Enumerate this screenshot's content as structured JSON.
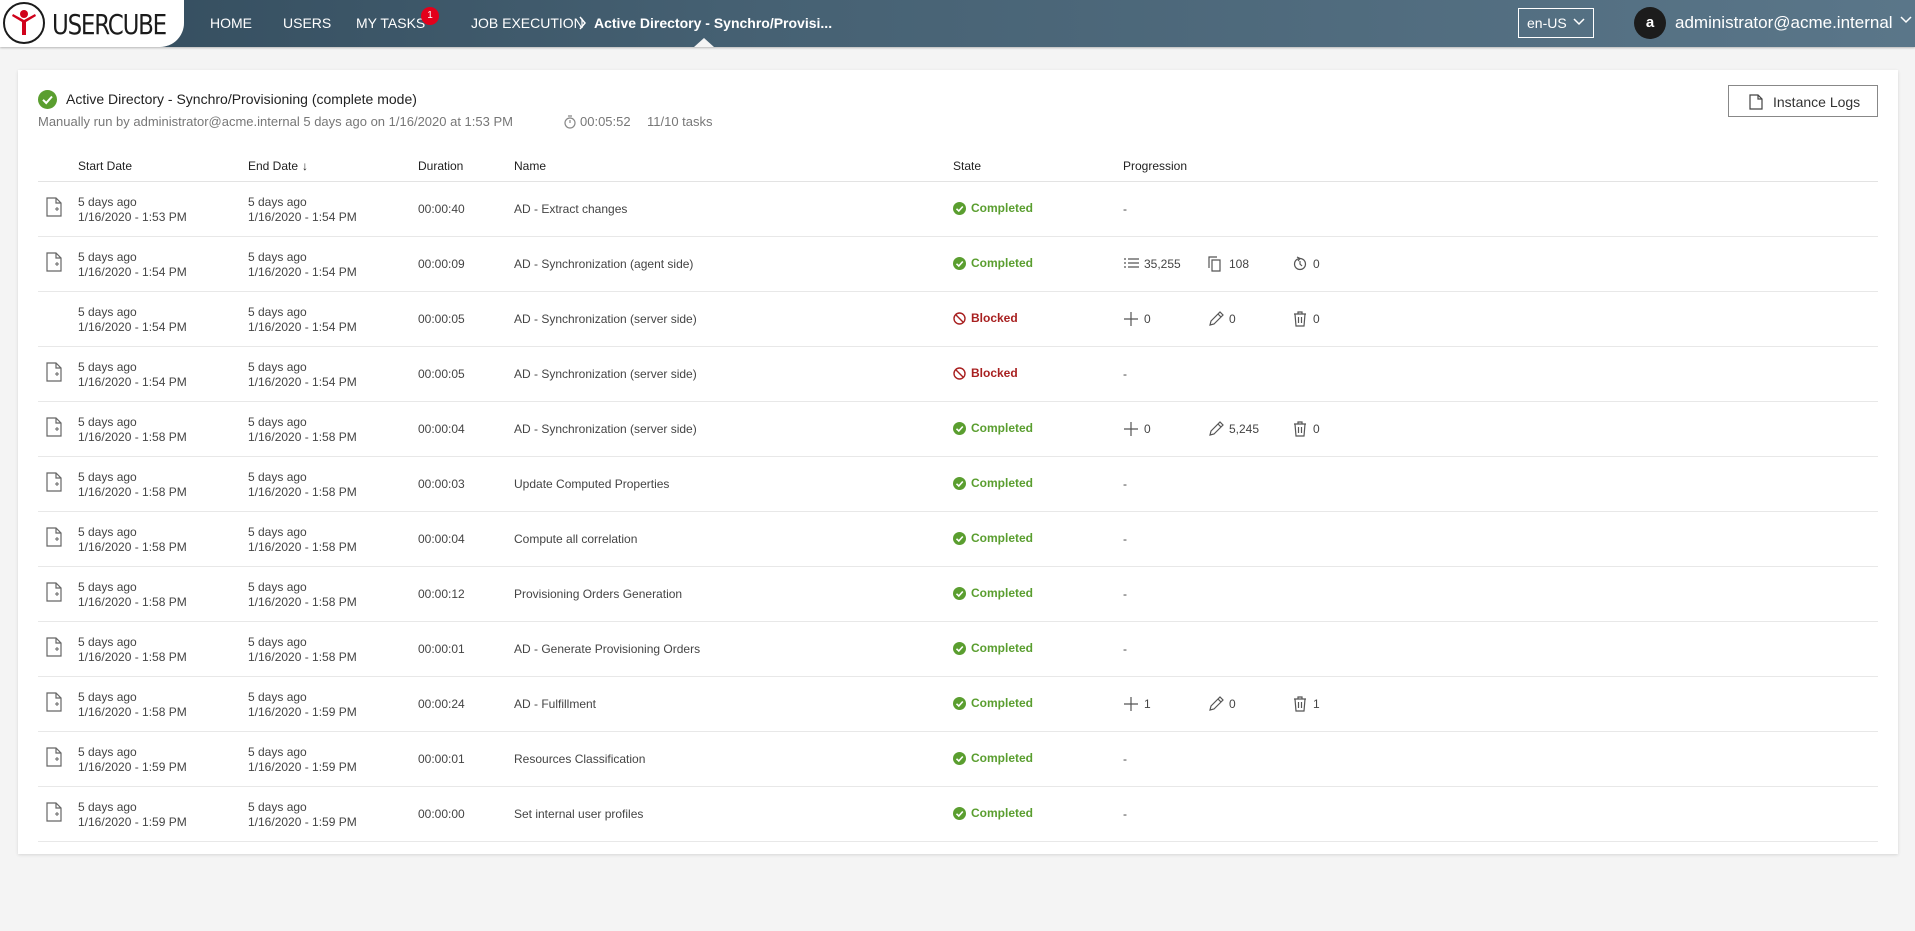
{
  "app": {
    "logo_text": "USERCUBE",
    "nav": {
      "home": "HOME",
      "users": "USERS",
      "my_tasks": "MY TASKS",
      "my_tasks_badge": "1",
      "job_execution": "JOB EXECUTION",
      "breadcrumb_current": "Active Directory - Synchro/Provisi..."
    },
    "language": "en-US",
    "user": {
      "avatar_letter": "a",
      "name": "administrator@acme.internal"
    }
  },
  "job": {
    "title": "Active Directory - Synchro/Provisioning (complete mode)",
    "subtitle": "Manually run by administrator@acme.internal 5 days ago on 1/16/2020 at 1:53 PM",
    "duration": "00:05:52",
    "tasks": "11/10 tasks",
    "instance_logs_label": "Instance Logs"
  },
  "table": {
    "headers": {
      "start": "Start Date",
      "end": "End Date",
      "duration": "Duration",
      "name": "Name",
      "state": "State",
      "progression": "Progression"
    },
    "rows": [
      {
        "icon": true,
        "start_rel": "5 days ago",
        "start": "1/16/2020 - 1:53 PM",
        "end_rel": "5 days ago",
        "end": "1/16/2020 - 1:54 PM",
        "duration": "00:00:40",
        "name": "AD - Extract changes",
        "state": "Completed",
        "progress": "-"
      },
      {
        "icon": true,
        "start_rel": "5 days ago",
        "start": "1/16/2020 - 1:54 PM",
        "end_rel": "5 days ago",
        "end": "1/16/2020 - 1:54 PM",
        "duration": "00:00:09",
        "name": "AD - Synchronization (agent side)",
        "state": "Completed",
        "progress_items": [
          {
            "icon": "list-icon",
            "value": "35,255"
          },
          {
            "icon": "copy-icon",
            "value": "108"
          },
          {
            "icon": "clock-refresh-icon",
            "value": "0"
          }
        ]
      },
      {
        "icon": false,
        "start_rel": "5 days ago",
        "start": "1/16/2020 - 1:54 PM",
        "end_rel": "5 days ago",
        "end": "1/16/2020 - 1:54 PM",
        "duration": "00:00:05",
        "name": "AD - Synchronization (server side)",
        "state": "Blocked",
        "progress_items": [
          {
            "icon": "plus-icon",
            "value": "0"
          },
          {
            "icon": "pencil-icon",
            "value": "0"
          },
          {
            "icon": "trash-icon",
            "value": "0"
          }
        ]
      },
      {
        "icon": true,
        "start_rel": "5 days ago",
        "start": "1/16/2020 - 1:54 PM",
        "end_rel": "5 days ago",
        "end": "1/16/2020 - 1:54 PM",
        "duration": "00:00:05",
        "name": "AD - Synchronization (server side)",
        "state": "Blocked",
        "progress": "-"
      },
      {
        "icon": true,
        "start_rel": "5 days ago",
        "start": "1/16/2020 - 1:58 PM",
        "end_rel": "5 days ago",
        "end": "1/16/2020 - 1:58 PM",
        "duration": "00:00:04",
        "name": "AD - Synchronization (server side)",
        "state": "Completed",
        "progress_items": [
          {
            "icon": "plus-icon",
            "value": "0"
          },
          {
            "icon": "pencil-icon",
            "value": "5,245"
          },
          {
            "icon": "trash-icon",
            "value": "0"
          }
        ]
      },
      {
        "icon": true,
        "start_rel": "5 days ago",
        "start": "1/16/2020 - 1:58 PM",
        "end_rel": "5 days ago",
        "end": "1/16/2020 - 1:58 PM",
        "duration": "00:00:03",
        "name": "Update Computed Properties",
        "state": "Completed",
        "progress": "-"
      },
      {
        "icon": true,
        "start_rel": "5 days ago",
        "start": "1/16/2020 - 1:58 PM",
        "end_rel": "5 days ago",
        "end": "1/16/2020 - 1:58 PM",
        "duration": "00:00:04",
        "name": "Compute all correlation",
        "state": "Completed",
        "progress": "-"
      },
      {
        "icon": true,
        "start_rel": "5 days ago",
        "start": "1/16/2020 - 1:58 PM",
        "end_rel": "5 days ago",
        "end": "1/16/2020 - 1:58 PM",
        "duration": "00:00:12",
        "name": "Provisioning Orders Generation",
        "state": "Completed",
        "progress": "-"
      },
      {
        "icon": true,
        "start_rel": "5 days ago",
        "start": "1/16/2020 - 1:58 PM",
        "end_rel": "5 days ago",
        "end": "1/16/2020 - 1:58 PM",
        "duration": "00:00:01",
        "name": "AD - Generate Provisioning Orders",
        "state": "Completed",
        "progress": "-"
      },
      {
        "icon": true,
        "start_rel": "5 days ago",
        "start": "1/16/2020 - 1:58 PM",
        "end_rel": "5 days ago",
        "end": "1/16/2020 - 1:59 PM",
        "duration": "00:00:24",
        "name": "AD - Fulfillment",
        "state": "Completed",
        "progress_items": [
          {
            "icon": "plus-icon",
            "value": "1"
          },
          {
            "icon": "pencil-icon",
            "value": "0"
          },
          {
            "icon": "trash-icon",
            "value": "1"
          }
        ]
      },
      {
        "icon": true,
        "start_rel": "5 days ago",
        "start": "1/16/2020 - 1:59 PM",
        "end_rel": "5 days ago",
        "end": "1/16/2020 - 1:59 PM",
        "duration": "00:00:01",
        "name": "Resources Classification",
        "state": "Completed",
        "progress": "-"
      },
      {
        "icon": true,
        "start_rel": "5 days ago",
        "start": "1/16/2020 - 1:59 PM",
        "end_rel": "5 days ago",
        "end": "1/16/2020 - 1:59 PM",
        "duration": "00:00:00",
        "name": "Set internal user profiles",
        "state": "Completed",
        "progress": "-"
      }
    ]
  },
  "colors": {
    "completed": "#5a9e2f",
    "blocked": "#a82020",
    "badge": "#e3001b"
  }
}
